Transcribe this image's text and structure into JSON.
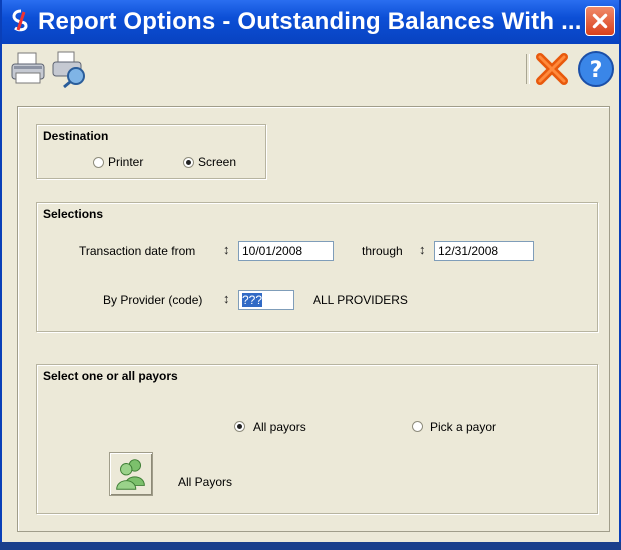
{
  "window": {
    "title": "Report Options - Outstanding Balances With ..."
  },
  "toolbar": {
    "print_icon": "printer-icon",
    "preview_icon": "print-preview-icon",
    "cancel_icon": "cancel-x-icon",
    "help_icon": "help-icon"
  },
  "destination": {
    "title": "Destination",
    "printer_label": "Printer",
    "screen_label": "Screen",
    "selected": "Screen"
  },
  "selections": {
    "title": "Selections",
    "date_from_label": "Transaction date from",
    "date_from_value": "10/01/2008",
    "through_label": "through",
    "date_through_value": "12/31/2008",
    "provider_label": "By Provider (code)",
    "provider_value": "???",
    "provider_name": "ALL PROVIDERS"
  },
  "payors": {
    "title": "Select one or all payors",
    "all_label": "All payors",
    "pick_label": "Pick a payor",
    "selected": "All payors",
    "button_label": "All Payors"
  },
  "colors": {
    "titlebar": "#0c4fd6",
    "window_bg": "#ece9d8",
    "selection": "#316ac5"
  }
}
